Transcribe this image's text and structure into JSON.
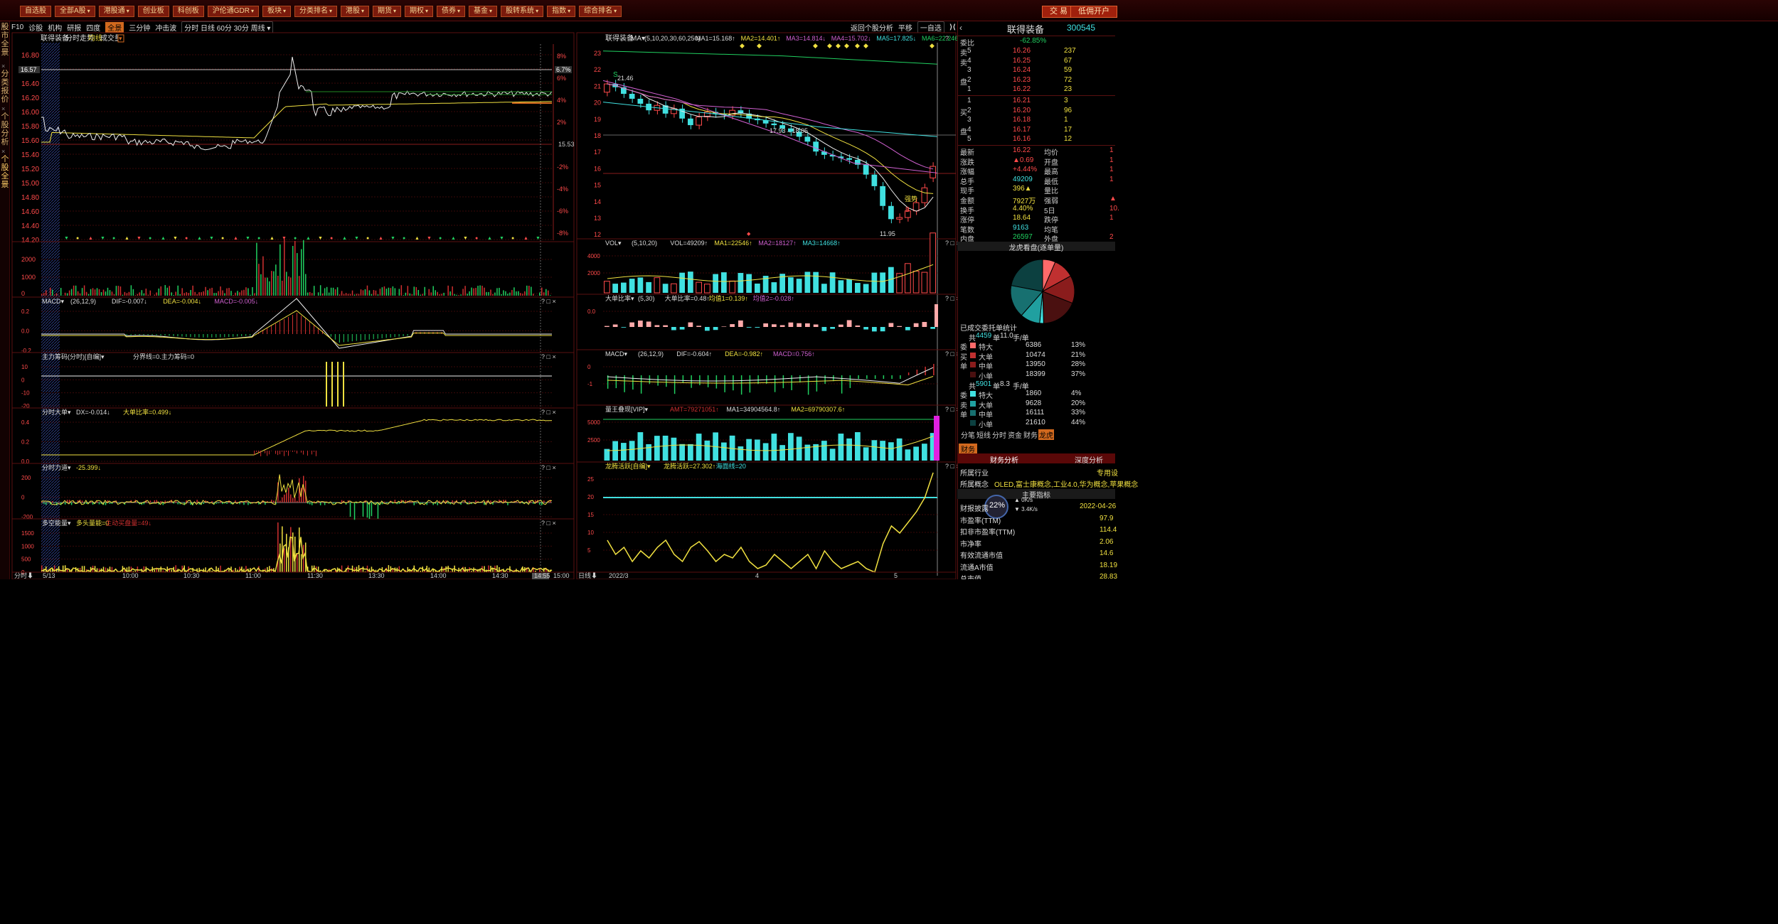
{
  "window": {
    "title": "…"
  },
  "topnav": [
    {
      "label": "自选股"
    },
    {
      "label": "全部A股",
      "dd": true
    },
    {
      "label": "港股通",
      "dd": true
    },
    {
      "label": "创业板"
    },
    {
      "label": "科创板"
    },
    {
      "label": "沪伦通GDR",
      "dd": true
    },
    {
      "label": "板块",
      "dd": true
    },
    {
      "label": "分类排名",
      "dd": true
    },
    {
      "label": "港股",
      "dd": true
    },
    {
      "label": "期货",
      "dd": true
    },
    {
      "label": "期权",
      "dd": true
    },
    {
      "label": "债券",
      "dd": true
    },
    {
      "label": "基金",
      "dd": true
    },
    {
      "label": "股转系统",
      "dd": true
    },
    {
      "label": "指数",
      "dd": true
    },
    {
      "label": "综合排名",
      "dd": true
    }
  ],
  "topright": {
    "trade": "交 易",
    "open_account": "低佣开户"
  },
  "left_tabs": [
    "股市全景",
    "分类报价",
    "个股分析",
    "个股全景"
  ],
  "toolbar": {
    "items": [
      "F10",
      "诊股",
      "机构",
      "研报",
      "四度",
      "全景",
      "三分钟",
      "冲击波"
    ],
    "active": "全景",
    "periods": [
      "分时",
      "日线",
      "60分",
      "30分",
      "周线"
    ],
    "right_items": [
      "返回个股分析",
      "平移",
      "一自选"
    ]
  },
  "intraday": {
    "header": {
      "name": "联得装备",
      "sub": "分时走势",
      "avg": "均线",
      "vol": "成交量"
    },
    "price_ticks": [
      "16.80",
      "16.60",
      "16.40",
      "16.20",
      "16.00",
      "15.80",
      "15.60",
      "15.40",
      "15.20",
      "15.00",
      "14.80",
      "14.60",
      "14.40",
      "14.20"
    ],
    "price_marker": "16.57",
    "pct_marker": "6.7%",
    "base_label": "15.53",
    "pct_ticks": [
      "8%",
      "6%",
      "4%",
      "2%",
      "-2%",
      "-4%",
      "-6%",
      "-8%"
    ],
    "vol_ticks": [
      "2000",
      "1000",
      "0"
    ],
    "time_labels": [
      "5/13",
      "10:00",
      "10:30",
      "11:00",
      "11:30",
      "13:30",
      "14:00",
      "14:30",
      "14:55",
      "15:00"
    ],
    "time_label_left": "分时"
  },
  "panels": [
    {
      "name": "MACD",
      "params": "(26,12,9)",
      "items": [
        {
          "t": "DIF=-0.007↓",
          "c": "#ddd"
        },
        {
          "t": "DEA=-0.004↓",
          "c": "#f0e040"
        },
        {
          "t": "MACD=-0.005↓",
          "c": "#d060d0"
        }
      ],
      "ticks": [
        "0.2",
        "0.0",
        "-0.2"
      ]
    },
    {
      "name": "主力筹码(分时)[自编]",
      "params": "",
      "items": [
        {
          "t": "分界线=0.主力筹码=0",
          "c": "#ddd"
        }
      ],
      "ticks": [
        "10",
        "0",
        "-10",
        "-20"
      ]
    },
    {
      "name": "分时大单",
      "params": "",
      "items": [
        {
          "t": "DX=-0.014↓",
          "c": "#ddd"
        },
        {
          "t": "大单比率=0.499↓",
          "c": "#f0e040"
        }
      ],
      "ticks": [
        "0.4",
        "0.2",
        "0.0"
      ]
    },
    {
      "name": "分时力道",
      "params": "",
      "items": [
        {
          "t": "-25.399↓",
          "c": "#f0e040"
        }
      ],
      "ticks": [
        "200",
        "0",
        "-200"
      ]
    },
    {
      "name": "多空能量",
      "params": "",
      "items": [
        {
          "t": "多头量能=0",
          "c": "#f0e040"
        },
        {
          "t": "主动买盘量=49↓",
          "c": "#d03030"
        }
      ],
      "ticks": [
        "1500",
        "1000",
        "500",
        "0"
      ]
    }
  ],
  "kline": {
    "header": {
      "name": "联得装备",
      "ma_label": "MA",
      "params": "(5,10,20,30,60,250)",
      "mas": [
        {
          "t": "MA1=15.168↑",
          "c": "#ddd"
        },
        {
          "t": "MA2=14.401↑",
          "c": "#f0e040"
        },
        {
          "t": "MA3=14.814↓",
          "c": "#d060d0"
        },
        {
          "t": "MA4=15.702↓",
          "c": "#d060d0"
        },
        {
          "t": "MA5=17.825↓",
          "c": "#40e0e0"
        },
        {
          "t": "MA6=22.246↓",
          "c": "#20d060"
        }
      ]
    },
    "y_ticks": [
      "23",
      "22",
      "21",
      "20",
      "19",
      "18",
      "17",
      "16",
      "15",
      "14",
      "13",
      "12"
    ],
    "annotations": {
      "high": "21.46",
      "mid": "17.93→18.05",
      "low": "11.95",
      "strong": "强势",
      "s": "S",
      "b": "B"
    },
    "x_labels": [
      "2022/3",
      "4",
      "5"
    ],
    "x_left": "日线"
  },
  "kpanels": [
    {
      "name": "VOL",
      "params": "(5,10,20)",
      "items": [
        {
          "t": "VOL=49209↑",
          "c": "#ddd"
        },
        {
          "t": "MA1=22546↑",
          "c": "#f0e040"
        },
        {
          "t": "MA2=18127↑",
          "c": "#d060d0"
        },
        {
          "t": "MA3=14668↑",
          "c": "#40e0e0"
        }
      ],
      "ticks": [
        "4000",
        "2000"
      ]
    },
    {
      "name": "大单比率",
      "params": "(5,30)",
      "items": [
        {
          "t": "大单比率=0.48↑",
          "c": "#ddd"
        },
        {
          "t": "均值1=0.139↑",
          "c": "#f0e040"
        },
        {
          "t": "均值2=-0.028↑",
          "c": "#d060d0"
        }
      ],
      "ticks": [
        "0.0"
      ]
    },
    {
      "name": "MACD",
      "params": "(26,12,9)",
      "items": [
        {
          "t": "DIF=-0.604↑",
          "c": "#ddd"
        },
        {
          "t": "DEA=-0.982↑",
          "c": "#f0e040"
        },
        {
          "t": "MACD=0.756↑",
          "c": "#d060d0"
        }
      ],
      "ticks": [
        "0",
        "-1"
      ]
    },
    {
      "name": "量王叠现[VIP]",
      "params": "",
      "items": [
        {
          "t": "AMT=79271051↑",
          "c": "#d03030"
        },
        {
          "t": "MA1=34904564.8↑",
          "c": "#ddd"
        },
        {
          "t": "MA2=69790307.6↑",
          "c": "#f0e040"
        }
      ],
      "ticks": [
        "5000",
        "2500"
      ]
    },
    {
      "name": "龙腾活跃[自编]",
      "params": "",
      "items": [
        {
          "t": "龙腾活跃=27.302↑",
          "c": "#f0e040"
        },
        {
          "t": "海面线=20",
          "c": "#40e0e0"
        }
      ],
      "ticks": [
        "25",
        "20",
        "15",
        "10",
        "5"
      ]
    }
  ],
  "quote": {
    "name": "联得装备",
    "code": "300545",
    "webi": {
      "label": "委比",
      "value": "-62.85%"
    },
    "asks": [
      {
        "label": "卖",
        "lv": "5",
        "price": "16.26",
        "vol": "237"
      },
      {
        "label": "卖",
        "lv": "4",
        "price": "16.25",
        "vol": "67"
      },
      {
        "label": "",
        "lv": "3",
        "price": "16.24",
        "vol": "59"
      },
      {
        "label": "盘",
        "lv": "2",
        "price": "16.23",
        "vol": "72"
      },
      {
        "label": "",
        "lv": "1",
        "price": "16.22",
        "vol": "23"
      }
    ],
    "bids": [
      {
        "label": "",
        "lv": "1",
        "price": "16.21",
        "vol": "3"
      },
      {
        "label": "买",
        "lv": "2",
        "price": "16.20",
        "vol": "96"
      },
      {
        "label": "",
        "lv": "3",
        "price": "16.18",
        "vol": "1"
      },
      {
        "label": "盘",
        "lv": "4",
        "price": "16.17",
        "vol": "17"
      },
      {
        "label": "",
        "lv": "5",
        "price": "16.16",
        "vol": "12"
      }
    ],
    "stats": [
      {
        "k1": "最新",
        "v1": "16.22",
        "k2": "均价",
        "v2": "1"
      },
      {
        "k1": "涨跌",
        "v1": "▲0.69",
        "k2": "开盘",
        "v2": "1"
      },
      {
        "k1": "涨幅",
        "v1": "+4.44%",
        "k2": "最高",
        "v2": "1"
      },
      {
        "k1": "总手",
        "v1": "49209",
        "k2": "最低",
        "v2": "1"
      },
      {
        "k1": "现手",
        "v1": "396▲",
        "k2": "量比",
        "v2": ""
      },
      {
        "k1": "金额",
        "v1": "7927万",
        "k2": "强弱",
        "v2": "▲"
      },
      {
        "k1": "换手",
        "v1": "4.40%",
        "k2": "5日",
        "v2": "10."
      },
      {
        "k1": "涨停",
        "v1": "18.64",
        "k2": "跌停",
        "v2": "1"
      },
      {
        "k1": "笔数",
        "v1": "9163",
        "k2": "均笔",
        "v2": ""
      },
      {
        "k1": "内盘",
        "v1": "26597",
        "k2": "外盘",
        "v2": "2"
      }
    ],
    "dragon": {
      "title": "龙虎看盘(逐单量)",
      "pie": [
        {
          "name": "买-特大",
          "value": 13,
          "color": "#ff6a6a"
        },
        {
          "name": "买-大单",
          "value": 21,
          "color": "#c03030"
        },
        {
          "name": "买-中单",
          "value": 28,
          "color": "#8a1c1c"
        },
        {
          "name": "买-小单",
          "value": 37,
          "color": "#4a1010"
        },
        {
          "name": "卖-特大",
          "value": 4,
          "color": "#40e0e0"
        },
        {
          "name": "卖-大单",
          "value": 20,
          "color": "#20a0a0"
        },
        {
          "name": "卖-中单",
          "value": 33,
          "color": "#177070"
        },
        {
          "name": "卖-小单",
          "value": 44,
          "color": "#0c4040"
        }
      ]
    },
    "orders_title": "已成交委托单统计",
    "buy_summary": {
      "pre": "共",
      "n": "4459",
      "mid": "单",
      "avg": "11.0",
      "post": "手/单"
    },
    "buy": [
      {
        "s": "委",
        "name": "特大",
        "vol": "6386",
        "pct": "13%",
        "color": "#ff6a6a"
      },
      {
        "s": "买",
        "name": "大单",
        "vol": "10474",
        "pct": "21%",
        "color": "#c03030"
      },
      {
        "s": "单",
        "name": "中单",
        "vol": "13950",
        "pct": "28%",
        "color": "#8a1c1c"
      },
      {
        "s": "",
        "name": "小单",
        "vol": "18399",
        "pct": "37%",
        "color": "#4a1010"
      }
    ],
    "sell_summary": {
      "pre": "共",
      "n": "5901",
      "mid": "单",
      "avg": "8.3",
      "post": "手/单"
    },
    "sell": [
      {
        "s": "委",
        "name": "特大",
        "vol": "1860",
        "pct": "4%",
        "color": "#40e0e0"
      },
      {
        "s": "卖",
        "name": "大单",
        "vol": "9628",
        "pct": "20%",
        "color": "#20a0a0"
      },
      {
        "s": "单",
        "name": "中单",
        "vol": "16111",
        "pct": "33%",
        "color": "#177070"
      },
      {
        "s": "",
        "name": "小单",
        "vol": "21610",
        "pct": "44%",
        "color": "#0c4040"
      }
    ],
    "tabs": [
      "分笔",
      "短线",
      "分时",
      "资金",
      "财务",
      "龙虎"
    ],
    "active_tab": "龙虎",
    "fin_tab": "财务",
    "fin_subtabs": [
      "财务分析",
      "深度分析"
    ],
    "industry": {
      "k": "所属行业",
      "v": "专用设"
    },
    "concept": {
      "k": "所属概念",
      "v": "OLED,富士康概念,工业4.0,华为概念,苹果概念"
    },
    "main_idx": "主要指标",
    "speed": {
      "pct": "22",
      "unit": "%",
      "up": "0K/s",
      "down": "3.4K/s"
    },
    "fin_rows": [
      {
        "k": "财报披露",
        "v": "2022-04-26"
      },
      {
        "k": "市盈率(TTM)",
        "v": "97.9"
      },
      {
        "k": "扣非市盈率(TTM)",
        "v": "114.4"
      },
      {
        "k": "市净率",
        "v": "2.06"
      },
      {
        "k": "有效流通市值",
        "v": "14.6"
      },
      {
        "k": "流通A市值",
        "v": "18.19"
      },
      {
        "k": "总市值",
        "v": "28.83"
      }
    ]
  }
}
